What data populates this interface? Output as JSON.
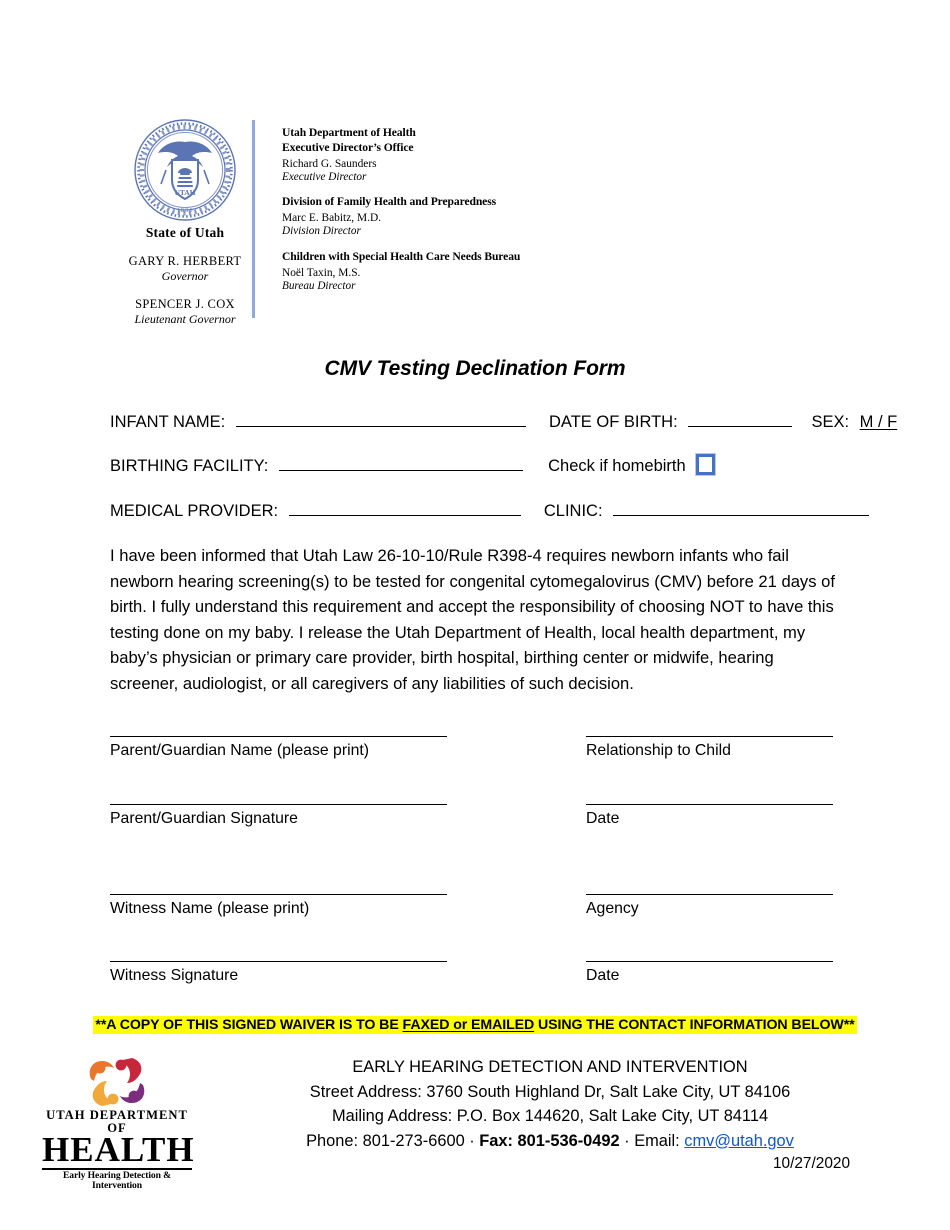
{
  "letterhead": {
    "seal_caption": "State of Utah",
    "governor_name": "GARY R.  HERBERT",
    "governor_title": "Governor",
    "lt_governor_name": "SPENCER J. COX",
    "lt_governor_title": "Lieutenant Governor",
    "groups": [
      {
        "heading_line1": "Utah Department of Health",
        "heading_line2": "Executive Director’s Office",
        "person": "Richard G. Saunders",
        "role": "Executive Director"
      },
      {
        "heading_line1": "Division of Family Health and Preparedness",
        "heading_line2": "",
        "person": "Marc E. Babitz, M.D.",
        "role": "Division Director"
      },
      {
        "heading_line1": "Children with Special Health Care Needs Bureau",
        "heading_line2": "",
        "person": "Noël Taxin, M.S.",
        "role": "Bureau Director"
      }
    ]
  },
  "title": "CMV Testing Declination Form",
  "fields": {
    "infant_name_label": "INFANT NAME:",
    "date_of_birth_label": "DATE OF BIRTH:",
    "sex_label": "SEX:",
    "sex_options": "M / F",
    "birthing_facility_label": "BIRTHING FACILITY:",
    "homebirth_label": "Check if homebirth",
    "medical_provider_label": "MEDICAL PROVIDER:",
    "clinic_label": "CLINIC:"
  },
  "body_paragraph": "I have been informed that Utah Law 26-10-10/Rule R398-4 requires newborn infants who fail newborn hearing screening(s) to be tested for congenital cytomegalovirus (CMV) before 21 days of birth. I fully understand this requirement and accept the responsibility of choosing NOT to have this testing done on my baby. I release the Utah Department of Health, local health department, my baby’s physician or primary care provider, birth hospital, birthing center or midwife, hearing screener, audiologist, or all caregivers of any liabilities of such decision.",
  "signatures": {
    "parent_name": "Parent/Guardian Name (please print)",
    "relationship": "Relationship to Child",
    "parent_signature": "Parent/Guardian Signature",
    "parent_date": "Date",
    "witness_name": "Witness Name (please print)",
    "agency": "Agency",
    "witness_signature": "Witness Signature",
    "witness_date": "Date"
  },
  "banner": {
    "prefix": "**A COPY OF THIS SIGNED WAIVER IS TO BE ",
    "underlined": "FAXED or EMAILED",
    "suffix": " USING THE CONTACT INFORMATION BELOW**",
    "highlight_color": "#FFFF00"
  },
  "footer": {
    "program_name": "EARLY HEARING DETECTION AND INTERVENTION",
    "street_address": "Street Address: 3760 South Highland Dr, Salt Lake City, UT  84106",
    "mailing_address": "Mailing Address: P.O. Box 144620, Salt Lake City, UT 84114",
    "phone_text": "Phone: 801-273-6600 · ",
    "fax_text": "Fax: 801-536-0492",
    "email_prefix": " · Email: ",
    "email": "cmv@utah.gov",
    "email_color": "#1155CC"
  },
  "logo": {
    "line1": "UTAH DEPARTMENT OF",
    "line2": "HEALTH",
    "tagline": "Early Hearing Detection & Intervention",
    "colors": {
      "orange": "#E8762C",
      "crimson": "#C8273B",
      "amber": "#F2A93B",
      "purple": "#7B2D7E"
    }
  },
  "date_stamp": "10/27/2020",
  "accent_colors": {
    "divider_blue": "#8FAADC",
    "checkbox_blue": "#4472C4",
    "seal_blue": "#5B74B4"
  }
}
